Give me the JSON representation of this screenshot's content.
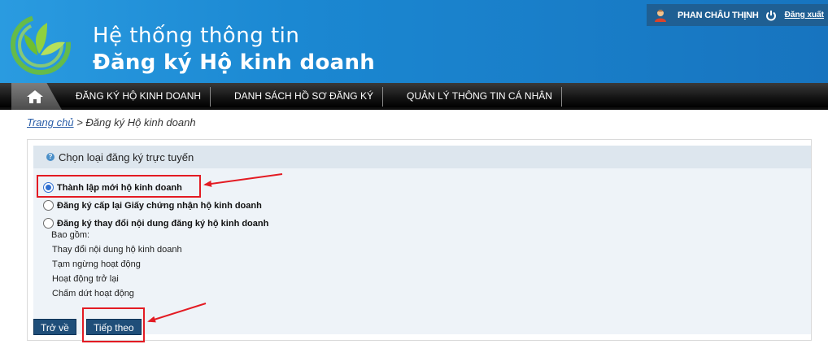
{
  "header": {
    "title": "Hệ thống thông tin",
    "subtitle": "Đăng ký Hộ kinh doanh",
    "user_name": "PHAN CHÂU THỊNH",
    "logout_label": "Đăng xuất"
  },
  "nav": {
    "items": [
      {
        "label": "ĐĂNG KÝ HỘ KINH DOANH"
      },
      {
        "label": "DANH SÁCH HỒ SƠ ĐĂNG KÝ"
      },
      {
        "label": "QUẢN LÝ THÔNG TIN CÁ NHÂN"
      }
    ]
  },
  "breadcrumb": {
    "home": "Trang chủ",
    "separator": ">",
    "current": "Đăng ký Hộ kinh doanh"
  },
  "panel": {
    "title": "Chọn loại đăng ký trực tuyến",
    "options": [
      {
        "label": "Thành lập mới hộ kinh doanh",
        "checked": true
      },
      {
        "label": "Đăng ký cấp lại Giấy chứng nhận hộ kinh doanh",
        "checked": false
      },
      {
        "label": "Đăng ký thay đổi nội dung đăng ký hộ kinh doanh",
        "checked": false
      }
    ],
    "includes_label": "Bao gồm:",
    "sub_items": [
      "Thay đổi nội dung hộ kinh doanh",
      "Tạm ngừng hoạt động",
      "Hoạt động trở lại",
      "Chấm dứt hoạt động"
    ]
  },
  "buttons": {
    "back": "Trở về",
    "next": "Tiếp theo"
  },
  "colors": {
    "header_blue": "#1b88d2",
    "nav_dark": "#141414",
    "button_blue": "#1f4e79",
    "highlight_red": "#e31b23"
  },
  "icons": {
    "logo": "leaf-swirl-logo",
    "user": "user-icon",
    "power": "power-icon",
    "home": "home-icon",
    "help": "question-icon"
  }
}
